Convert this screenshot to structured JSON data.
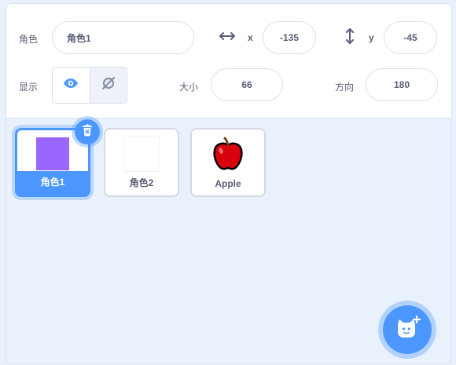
{
  "sprite_info": {
    "sprite_label": "角色",
    "sprite_name": "角色1",
    "x_label": "x",
    "x_value": "-135",
    "y_label": "y",
    "y_value": "-45",
    "show_label": "显示",
    "size_label": "大小",
    "size_value": "66",
    "direction_label": "方向",
    "direction_value": "180"
  },
  "sprites": [
    {
      "name": "角色1",
      "selected": true,
      "thumb_color": "#9966ff"
    },
    {
      "name": "角色2",
      "selected": false,
      "thumb_color": "#ffffff"
    },
    {
      "name": "Apple",
      "selected": false
    }
  ],
  "colors": {
    "accent": "#4c97ff",
    "apple_red": "#d9000d"
  },
  "icons": [
    "horizontal-arrow-icon",
    "vertical-arrow-icon",
    "eye-icon",
    "eye-hidden-icon",
    "trash-icon",
    "add-sprite-icon"
  ]
}
